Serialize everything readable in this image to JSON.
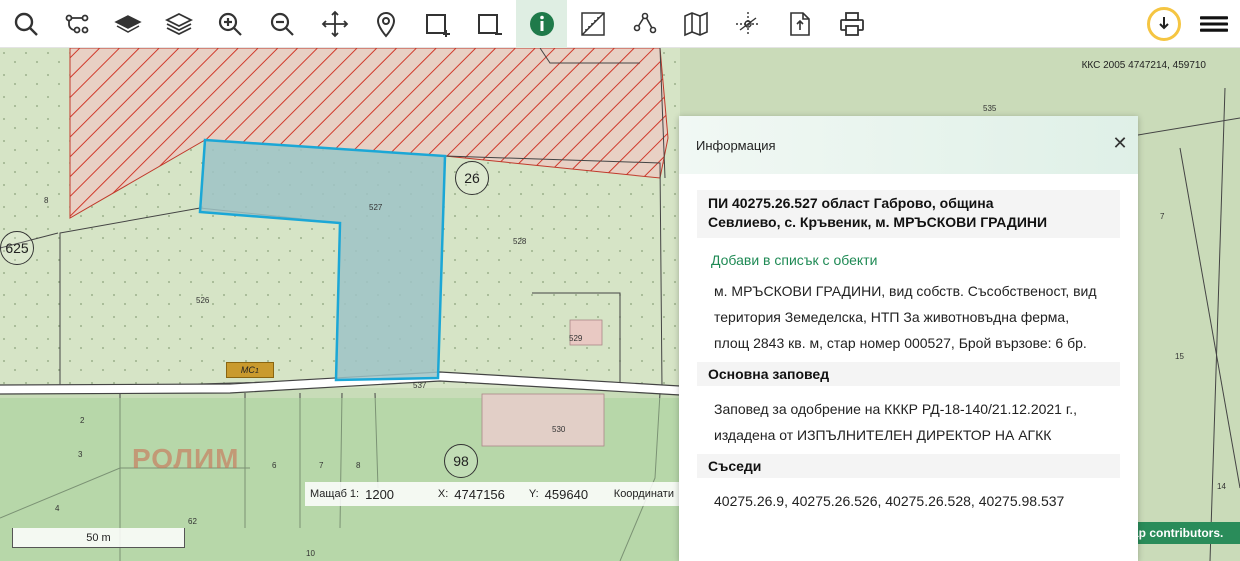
{
  "toolbar": {
    "left_icons": [
      "search-icon",
      "route-icon",
      "layer-icon",
      "layers-icon",
      "zoom-in-icon",
      "zoom-out-icon",
      "pan-icon",
      "location-pin-icon",
      "draw-area-add-icon",
      "draw-area-remove-icon",
      "info-icon",
      "ruler-icon",
      "measure-icon",
      "map-icon",
      "coordinates-icon",
      "export-icon",
      "print-icon"
    ],
    "active_tool": "info-icon",
    "right_icons": [
      "download-icon",
      "menu-icon"
    ],
    "accent": "#1f7a4a"
  },
  "map": {
    "crs_label": "ККС 2005 4747214, 459710",
    "parcels": [
      "527",
      "528",
      "526",
      "529",
      "530",
      "535",
      "537",
      "8",
      "2",
      "3",
      "4",
      "6",
      "7",
      "8",
      "62",
      "10",
      "7",
      "15",
      "14"
    ],
    "circle_labels": [
      "26",
      "625",
      "98"
    ],
    "building_label": "МС",
    "building_sup": "1",
    "watermark": "РОЛИМ",
    "coord_bar": {
      "scale_label": "Мащаб 1:",
      "scale_value": "1200",
      "x_label": "X:",
      "x_value": "4747156",
      "y_label": "Y:",
      "y_value": "459640",
      "coord_label": "Координати"
    },
    "scale_bar": "50 m",
    "attribution": "ap contributors.",
    "colors": {
      "selected_parcel": "#1ba7d6",
      "hatch": "#d03a2c"
    }
  },
  "panel": {
    "header": "Информация",
    "title_line1": "ПИ 40275.26.527 област Габрово, община",
    "title_line2": "Севлиево, с. Кръвеник, м. МРЪСКОВИ ГРАДИНИ",
    "add_link": "Добави в списък с обекти",
    "details_line1": "м. МРЪСКОВИ ГРАДИНИ, вид собств. Съсобственост, вид",
    "details_line2": "територия Земеделска, НТП За животновъдна ферма,",
    "details_line3": "площ 2843 кв. м, стар номер 000527, Брой вързове: 6 бр.",
    "order_heading": "Основна заповед",
    "order_line1": "Заповед за одобрение на КККР РД-18-140/21.12.2021 г.,",
    "order_line2": "издадена от ИЗПЪЛНИТЕЛЕН ДИРЕКТОР НА АГКК",
    "neighbors_heading": "Съседи",
    "neighbors": "40275.26.9, 40275.26.526, 40275.26.528, 40275.98.537"
  }
}
